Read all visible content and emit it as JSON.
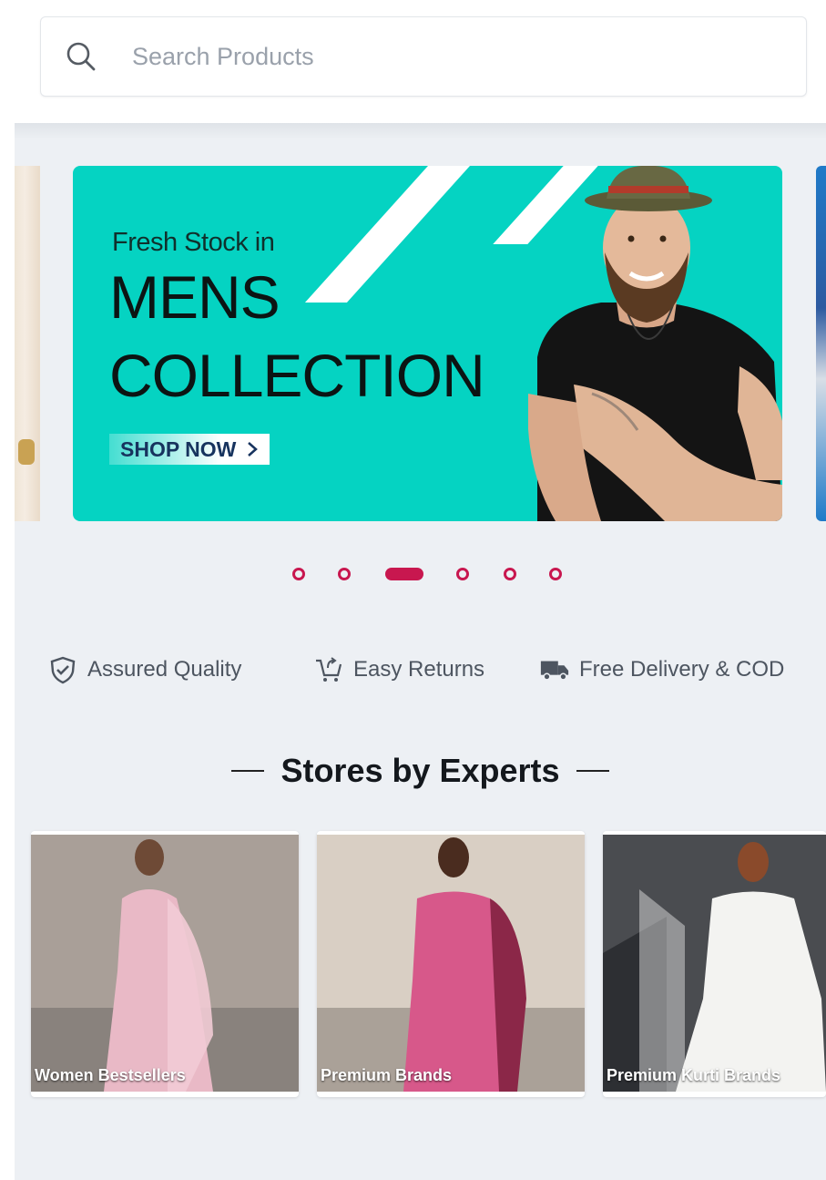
{
  "search": {
    "placeholder": "Search Products",
    "icon": "search-icon"
  },
  "banner": {
    "kicker": "Fresh Stock in",
    "line1": "MENS",
    "line2": "COLLECTION",
    "cta": "SHOP NOW",
    "cta_icon": "chevron-right-icon",
    "background_color": "#05d3c2"
  },
  "carousel": {
    "slide_count": 6,
    "active_index": 2,
    "accent_color": "#c8174f"
  },
  "features": [
    {
      "icon": "shield-check-icon",
      "label": "Assured Quality"
    },
    {
      "icon": "cart-return-icon",
      "label": "Easy Returns"
    },
    {
      "icon": "delivery-truck-icon",
      "label": "Free Delivery & COD"
    }
  ],
  "stores_section": {
    "title": "Stores by Experts",
    "items": [
      {
        "label": "Women Bestsellers"
      },
      {
        "label": "Premium Brands"
      },
      {
        "label": "Premium Kurti Brands"
      }
    ]
  }
}
